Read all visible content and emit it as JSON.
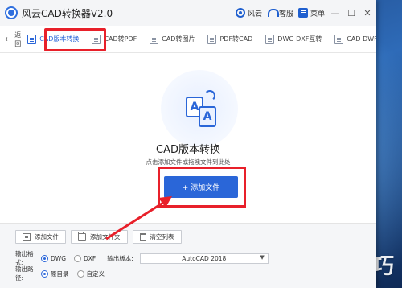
{
  "app": {
    "title": "风云CAD转换器V2.0",
    "title_links": [
      {
        "label": "风云",
        "icon": "brand-icon"
      },
      {
        "label": "客服",
        "icon": "headset-icon"
      },
      {
        "label": "菜单",
        "icon": "menu-icon"
      }
    ],
    "window_controls": [
      "—",
      "☐",
      "✕"
    ]
  },
  "toolbar": {
    "back_label": "返回",
    "tabs": [
      {
        "label": "CAD版本转换",
        "active": true
      },
      {
        "label": "CAD转PDF",
        "active": false
      },
      {
        "label": "CAD转图片",
        "active": false
      },
      {
        "label": "PDF转CAD",
        "active": false
      },
      {
        "label": "DWG DXF互转",
        "active": false
      },
      {
        "label": "CAD DWF互转",
        "active": false
      }
    ]
  },
  "main": {
    "hero_letters": [
      "A",
      "A"
    ],
    "title": "CAD版本转换",
    "hint": "点击添加文件或拖拽文件到此处",
    "add_button": "+ 添加文件"
  },
  "bottom": {
    "buttons": [
      "添加文件",
      "添加文件夹",
      "清空列表"
    ],
    "format_label": "输出格式:",
    "formats": [
      {
        "label": "DWG",
        "selected": true
      },
      {
        "label": "DXF",
        "selected": false
      }
    ],
    "version_label": "输出版本:",
    "version_value": "AutoCAD 2018",
    "path_label": "输出路径:",
    "paths": [
      {
        "label": "原目录",
        "selected": true
      },
      {
        "label": "自定义",
        "selected": false
      }
    ]
  },
  "watermark": "软件技巧",
  "colors": {
    "accent": "#2a66d8",
    "highlight": "#e8202a"
  }
}
